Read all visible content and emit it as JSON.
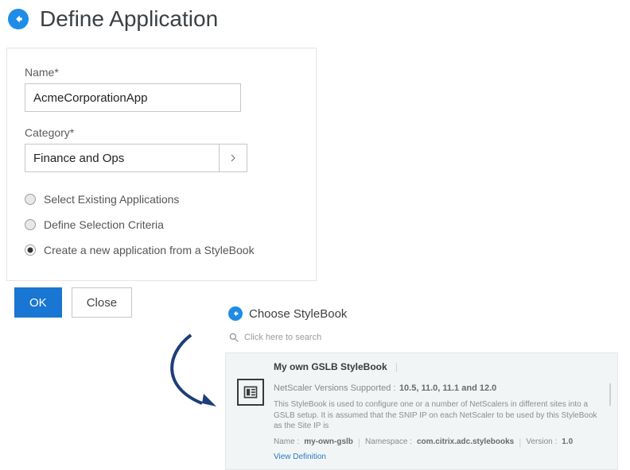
{
  "header": {
    "title": "Define Application"
  },
  "form": {
    "name_label": "Name*",
    "name_value": "AcmeCorporationApp",
    "category_label": "Category*",
    "category_value": "Finance and Ops",
    "radios": {
      "r0": "Select Existing Applications",
      "r1": "Define Selection Criteria",
      "r2": "Create a new application from a StyleBook"
    }
  },
  "buttons": {
    "ok": "OK",
    "close": "Close"
  },
  "panel": {
    "title": "Choose StyleBook",
    "search_placeholder": "Click here to search",
    "card": {
      "title": "My own GSLB StyleBook",
      "ns_versions_label": "NetScaler Versions Supported :",
      "ns_versions_value": "10.5, 11.0, 11.1 and 12.0",
      "description": "This StyleBook is used to configure one or a number of NetScalers in different sites into a GSLB setup. It is assumed that the SNIP IP on each NetScaler to be used by this StyleBook as the Site IP is",
      "name_label": "Name :",
      "name_value": "my-own-gslb",
      "namespace_label": "Namespace :",
      "namespace_value": "com.citrix.adc.stylebooks",
      "version_label": "Version :",
      "version_value": "1.0",
      "view_definition": "View Definition"
    }
  }
}
